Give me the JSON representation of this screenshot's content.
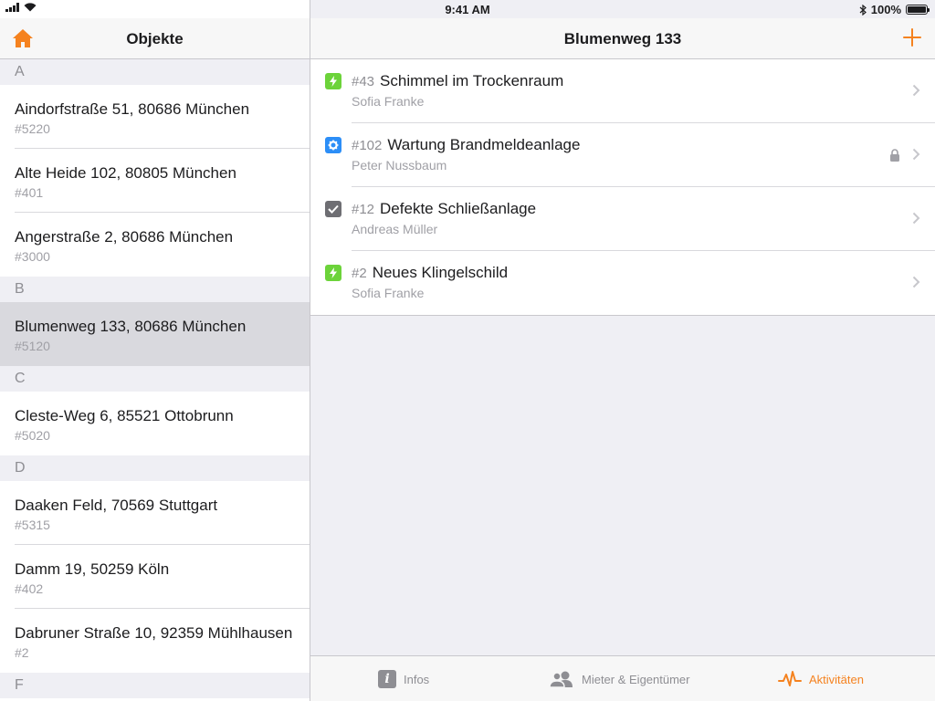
{
  "status_bar": {
    "time": "9:41 AM",
    "battery": "100%"
  },
  "master": {
    "title": "Objekte",
    "sections": [
      {
        "letter": "A",
        "items": [
          {
            "address": "Aindorfstraße 51, 80686 München",
            "number": "#5220"
          },
          {
            "address": "Alte Heide 102, 80805 München",
            "number": "#401"
          },
          {
            "address": "Angerstraße 2, 80686 München",
            "number": "#3000"
          }
        ]
      },
      {
        "letter": "B",
        "items": [
          {
            "address": "Blumenweg 133, 80686 München",
            "number": "#5120",
            "selected": true
          }
        ]
      },
      {
        "letter": "C",
        "items": [
          {
            "address": "Cleste-Weg 6, 85521 Ottobrunn",
            "number": "#5020"
          }
        ]
      },
      {
        "letter": "D",
        "items": [
          {
            "address": "Daaken Feld, 70569 Stuttgart",
            "number": "#5315"
          },
          {
            "address": "Damm 19, 50259 Köln",
            "number": "#402"
          },
          {
            "address": "Dabruner Straße 10, 92359 Mühlhausen",
            "number": "#2"
          }
        ]
      },
      {
        "letter": "F",
        "items": []
      }
    ]
  },
  "detail": {
    "title": "Blumenweg 133",
    "activities": [
      {
        "number": "#43",
        "title": "Schimmel im Trockenraum",
        "person": "Sofia Franke",
        "icon": "bolt-icon",
        "color": "#6cd33a",
        "locked": false
      },
      {
        "number": "#102",
        "title": "Wartung Brandmeldeanlage",
        "person": "Peter Nussbaum",
        "icon": "gear-icon",
        "color": "#2c8ef7",
        "locked": true
      },
      {
        "number": "#12",
        "title": "Defekte Schließanlage",
        "person": "Andreas Müller",
        "icon": "checkmark-icon",
        "color": "#6e6e73",
        "locked": false
      },
      {
        "number": "#2",
        "title": "Neues Klingelschild",
        "person": "Sofia Franke",
        "icon": "bolt-icon",
        "color": "#6cd33a",
        "locked": false
      }
    ],
    "tabs": [
      {
        "label": "Infos",
        "icon": "info-icon",
        "active": false
      },
      {
        "label": "Mieter & Eigentümer",
        "icon": "people-icon",
        "active": false
      },
      {
        "label": "Aktivitäten",
        "icon": "activity-pulse-icon",
        "active": true
      }
    ]
  },
  "colors": {
    "accent": "#f5821f",
    "selected_row": "#d9d9de"
  }
}
